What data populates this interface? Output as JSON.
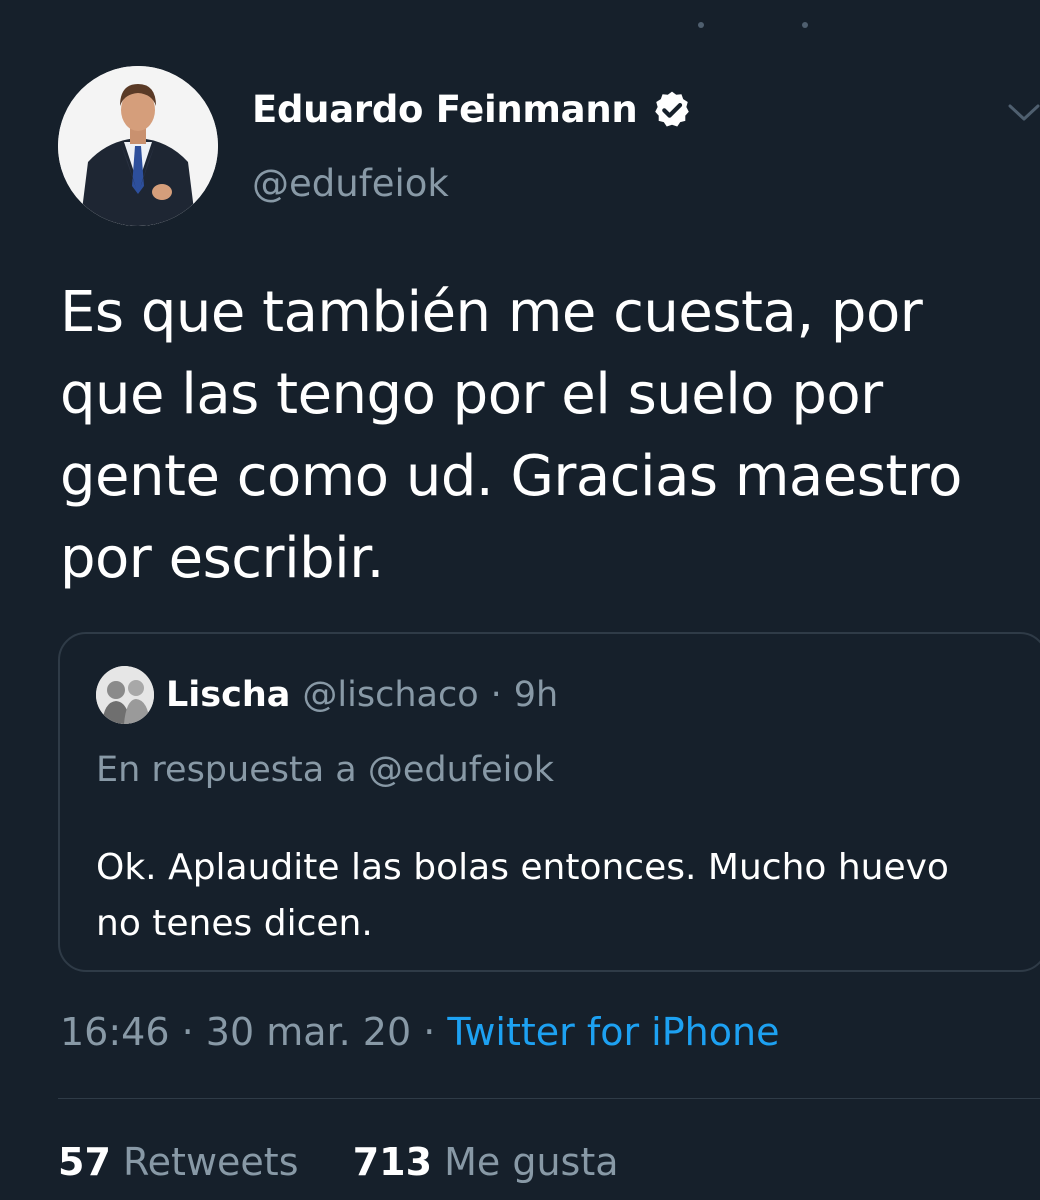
{
  "tweet": {
    "author": {
      "display_name": "Eduardo Feinmann",
      "handle": "@edufeiok",
      "verified": true,
      "avatar_icon": "profile-photo-man-in-suit"
    },
    "text": "Es que también me cuesta, por que las tengo por el suelo por gente como ud. Gracias maestro por escribir.",
    "meta": {
      "time": "16:46",
      "separator": " · ",
      "date": "30 mar. 20",
      "source": "Twitter for iPhone"
    },
    "stats": {
      "retweets_count": "57",
      "retweets_label": "Retweets",
      "likes_count": "713",
      "likes_label": "Me gusta"
    },
    "menu_icon": "chevron-down-icon"
  },
  "quoted": {
    "display_name": "Lischa",
    "handle": "@lischaco",
    "separator": "·",
    "time": "9h",
    "reply_prefix": "En respuesta a",
    "reply_handle": "@edufeiok",
    "text": "Ok. Aplaudite las bolas entonces. Mucho huevo no tenes dicen."
  },
  "colors": {
    "background": "#16202b",
    "secondary_text": "#8899a6",
    "link": "#1da1f2",
    "border": "#2f3b47"
  }
}
